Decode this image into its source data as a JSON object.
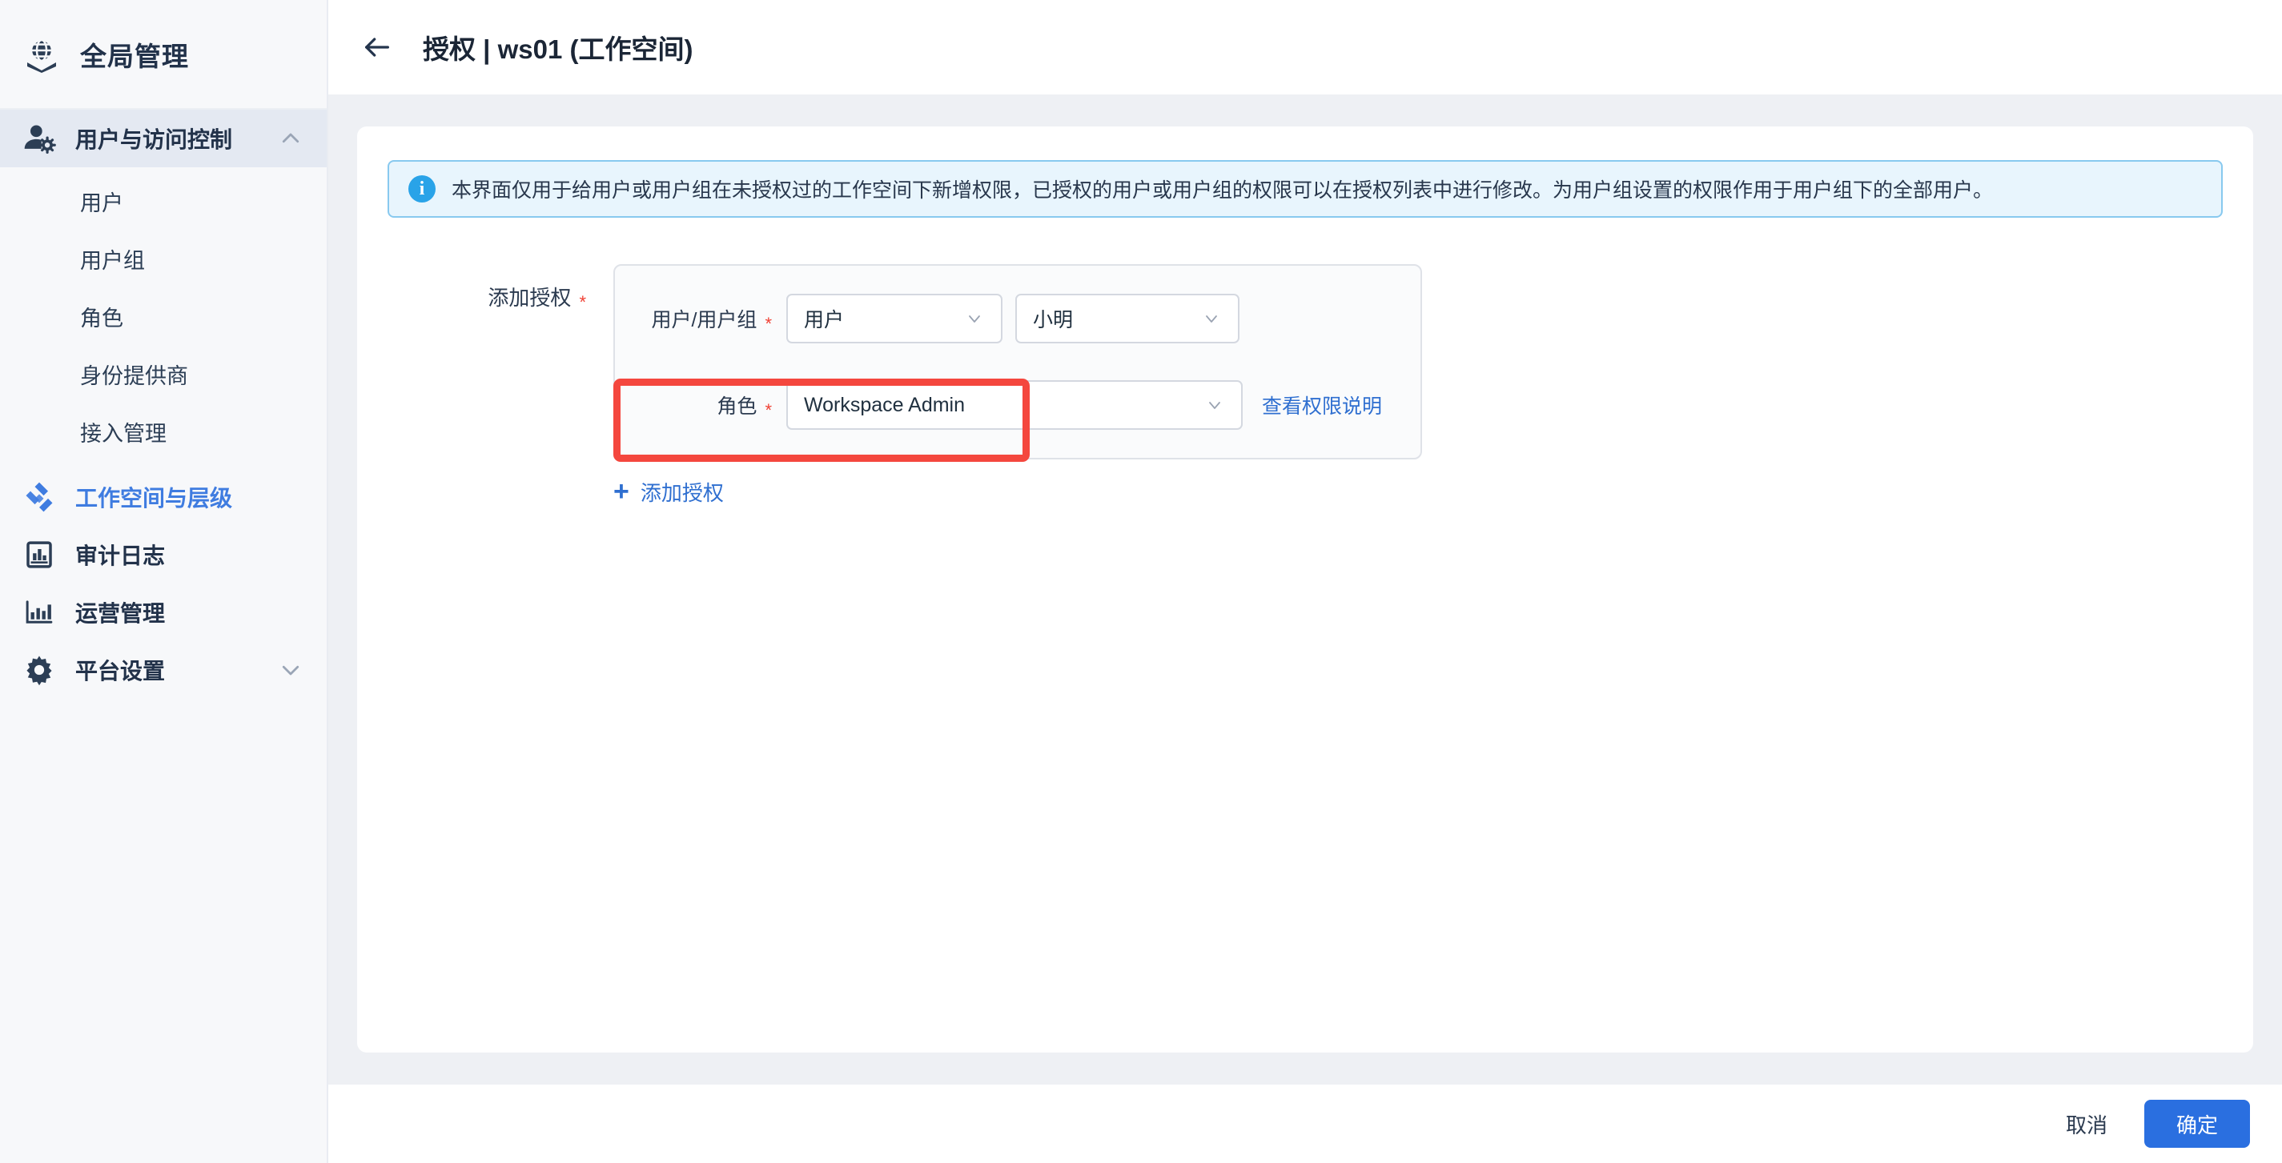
{
  "sidebar": {
    "brand": {
      "icon": "globe-shield-icon",
      "title": "全局管理"
    },
    "group": {
      "icon": "user-gear-icon",
      "label": "用户与访问控制",
      "chevron": "chevron-up-icon",
      "items": [
        {
          "label": "用户"
        },
        {
          "label": "用户组"
        },
        {
          "label": "角色"
        },
        {
          "label": "身份提供商"
        },
        {
          "label": "接入管理"
        }
      ]
    },
    "items": [
      {
        "icon": "workspace-icon",
        "label": "工作空间与层级",
        "active": true
      },
      {
        "icon": "audit-log-icon",
        "label": "审计日志",
        "active": false
      },
      {
        "icon": "operations-icon",
        "label": "运营管理",
        "active": false
      },
      {
        "icon": "gear-icon",
        "label": "平台设置",
        "active": false,
        "chevron": "chevron-down-icon"
      }
    ]
  },
  "topbar": {
    "back_icon": "arrow-left-icon",
    "title": "授权 | ws01 (工作空间)"
  },
  "alert": {
    "icon": "info-icon",
    "text": "本界面仅用于给用户或用户组在未授权过的工作空间下新增权限，已授权的用户或用户组的权限可以在授权列表中进行修改。为用户组设置的权限作用于用户组下的全部用户。"
  },
  "form": {
    "section_label": "添加授权",
    "required_mark": "*",
    "rows": {
      "user": {
        "label": "用户/用户组",
        "required_mark": "*",
        "type_value": "用户",
        "type_caret": "chevron-down-icon",
        "user_value": "小明",
        "user_caret": "chevron-down-icon"
      },
      "role": {
        "label": "角色",
        "required_mark": "*",
        "value": "Workspace Admin",
        "caret": "chevron-down-icon",
        "link": "查看权限说明"
      }
    },
    "add_link": {
      "plus": "+",
      "label": "添加授权"
    }
  },
  "footer": {
    "cancel_label": "取消",
    "confirm_label": "确定"
  },
  "colors": {
    "accent": "#2a6fe0",
    "highlight": "#f4473e",
    "required": "#f04134",
    "info_bg": "#e8f5fd",
    "info_border": "#88c9ef",
    "sidebar_bg": "#f7f8fa",
    "page_bg": "#eef0f4"
  }
}
